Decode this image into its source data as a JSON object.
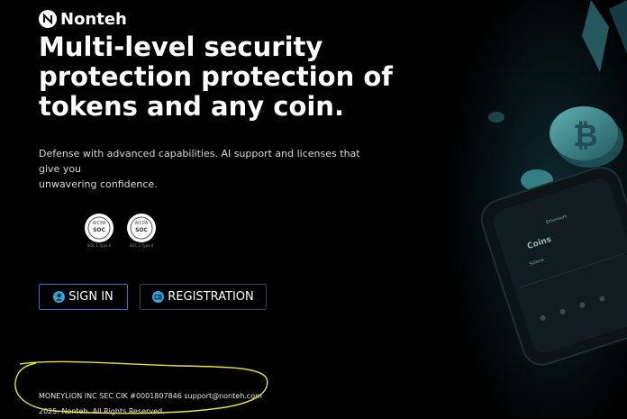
{
  "brand": {
    "name": "Nonteh"
  },
  "hero": {
    "headline_lines": [
      "Multi-level security",
      "protection protection of",
      "tokens and any coin."
    ],
    "subtitle_lines": [
      "Defense with advanced capabilities. AI support and licenses that give you",
      "unwavering confidence."
    ]
  },
  "badges": [
    {
      "ring": "AICPA",
      "center": "SOC",
      "caption": "SOC 1 Type II"
    },
    {
      "ring": "AICPA",
      "center": "SOC",
      "caption": "SOC 2 Type II"
    }
  ],
  "actions": {
    "signin_label": "SIGN IN",
    "registration_label": "REGISTRATION"
  },
  "footer": {
    "company_line": "MONEYLION INC SEC CIK #0001807846 support@nonteh.com",
    "rights_line": "2025. Nonteh. All Rights Reserved."
  },
  "phone": {
    "coins_label": "Coins",
    "coin_names": [
      "Ethereum",
      "Solana"
    ]
  },
  "colors": {
    "accent": "#3a6fd6",
    "icon_fill": "#2ea6dd",
    "annotation": "#e8e236",
    "coin": "#3a8a8f"
  }
}
